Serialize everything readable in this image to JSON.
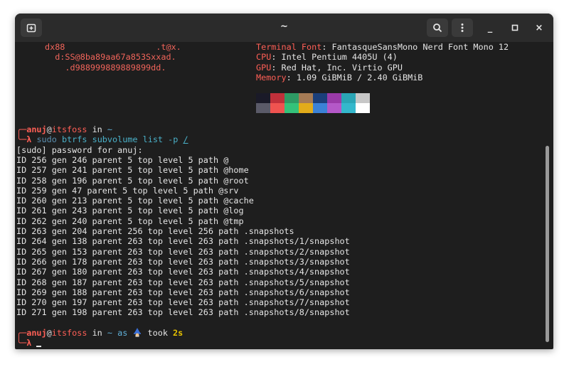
{
  "window": {
    "title": "~",
    "newtab_icon": "new-tab-icon",
    "search_icon": "search-icon",
    "menu_icon": "kebab-menu-icon",
    "minimize_glyph": "_",
    "maximize_glyph": "□",
    "close_glyph": "×"
  },
  "fastfetch": {
    "ascii": [
      "dx88                  .t@x.",
      "  d:SS@8ba89aa67a853Sxxad.",
      "    .d988999889889899dd."
    ],
    "info": [
      {
        "label": "Terminal Font",
        "value": ": FantasqueSansMono Nerd Font Mono 12"
      },
      {
        "label": "CPU",
        "value": ": Intel Pentium 4405U (4)"
      },
      {
        "label": "GPU",
        "value": ": Red Hat, Inc. Virtio GPU"
      },
      {
        "label": "Memory",
        "value": ": 1.09 GiBMiB / 2.40 GiBMiB"
      }
    ],
    "palette_top": [
      "#1a1a28",
      "#c0303a",
      "#2e9a64",
      "#a57b55",
      "#1b3f7a",
      "#9a3aa8",
      "#2aa5b5",
      "#c7c7c7"
    ],
    "palette_bottom": [
      "#5a5a68",
      "#ef5350",
      "#34c27a",
      "#e2ac1a",
      "#3b82d6",
      "#b458c8",
      "#34b8cc",
      "#ffffff"
    ]
  },
  "prompt1": {
    "user": "anuj",
    "at": "@",
    "host": "itsfoss",
    "in": " in ",
    "dir": "~",
    "lambda": "λ",
    "cmd_sudo": "sudo",
    "cmd_btrfs": "btrfs",
    "cmd_rest": "subvolume list -p",
    "cmd_path": "/"
  },
  "output": [
    "[sudo] password for anuj:",
    "ID 256 gen 246 parent 5 top level 5 path @",
    "ID 257 gen 241 parent 5 top level 5 path @home",
    "ID 258 gen 196 parent 5 top level 5 path @root",
    "ID 259 gen 47 parent 5 top level 5 path @srv",
    "ID 260 gen 213 parent 5 top level 5 path @cache",
    "ID 261 gen 243 parent 5 top level 5 path @log",
    "ID 262 gen 240 parent 5 top level 5 path @tmp",
    "ID 263 gen 204 parent 256 top level 256 path .snapshots",
    "ID 264 gen 138 parent 263 top level 263 path .snapshots/1/snapshot",
    "ID 265 gen 153 parent 263 top level 263 path .snapshots/2/snapshot",
    "ID 266 gen 178 parent 263 top level 263 path .snapshots/3/snapshot",
    "ID 267 gen 180 parent 263 top level 263 path .snapshots/4/snapshot",
    "ID 268 gen 187 parent 263 top level 263 path .snapshots/5/snapshot",
    "ID 269 gen 188 parent 263 top level 263 path .snapshots/6/snapshot",
    "ID 270 gen 197 parent 263 top level 263 path .snapshots/7/snapshot",
    "ID 271 gen 198 parent 263 top level 263 path .snapshots/8/snapshot"
  ],
  "prompt2": {
    "user": "anuj",
    "at": "@",
    "host": "itsfoss",
    "in": " in ",
    "dir": "~",
    "as": " as ",
    "wizard_icon": "wizard-emoji-icon",
    "took": " took ",
    "duration": "2s",
    "lambda": "λ"
  },
  "colors": {
    "accent_red": "#ff5f56",
    "duration_yellow": "#e5c100",
    "background": "#1e1e1e"
  }
}
